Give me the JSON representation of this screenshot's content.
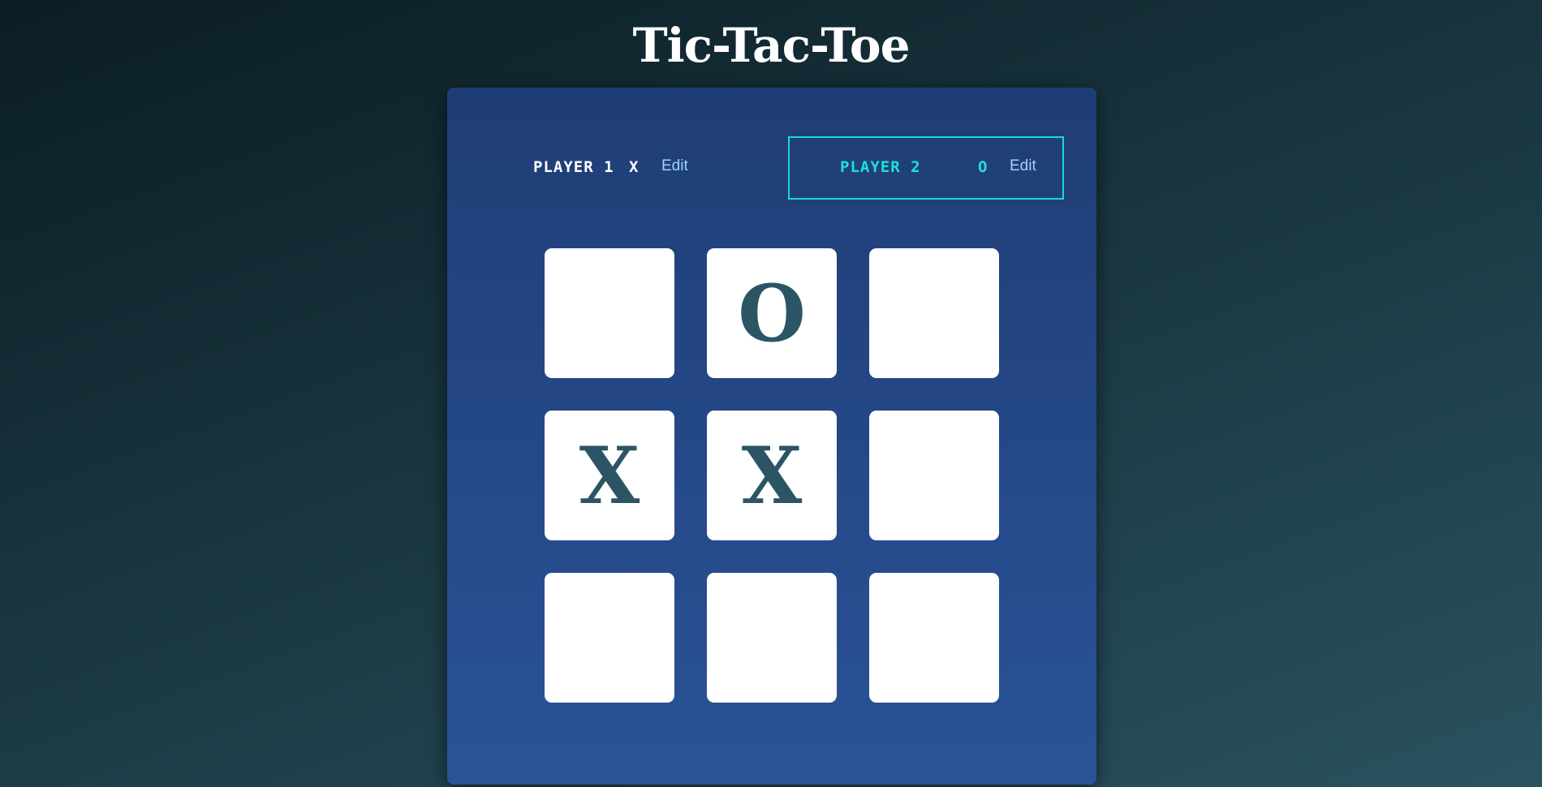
{
  "title": "Tic-Tac-Toe",
  "players": [
    {
      "name": "PLAYER 1",
      "symbol": "X",
      "edit_label": "Edit",
      "active": false
    },
    {
      "name": "PLAYER 2",
      "symbol": "O",
      "edit_label": "Edit",
      "active": true
    }
  ],
  "board": [
    [
      "",
      "O",
      ""
    ],
    [
      "X",
      "X",
      ""
    ],
    [
      "",
      "",
      ""
    ]
  ],
  "colors": {
    "active_player": "#1fd6d6",
    "mark": "#2b5565",
    "edit_link": "#9fd0ff"
  }
}
